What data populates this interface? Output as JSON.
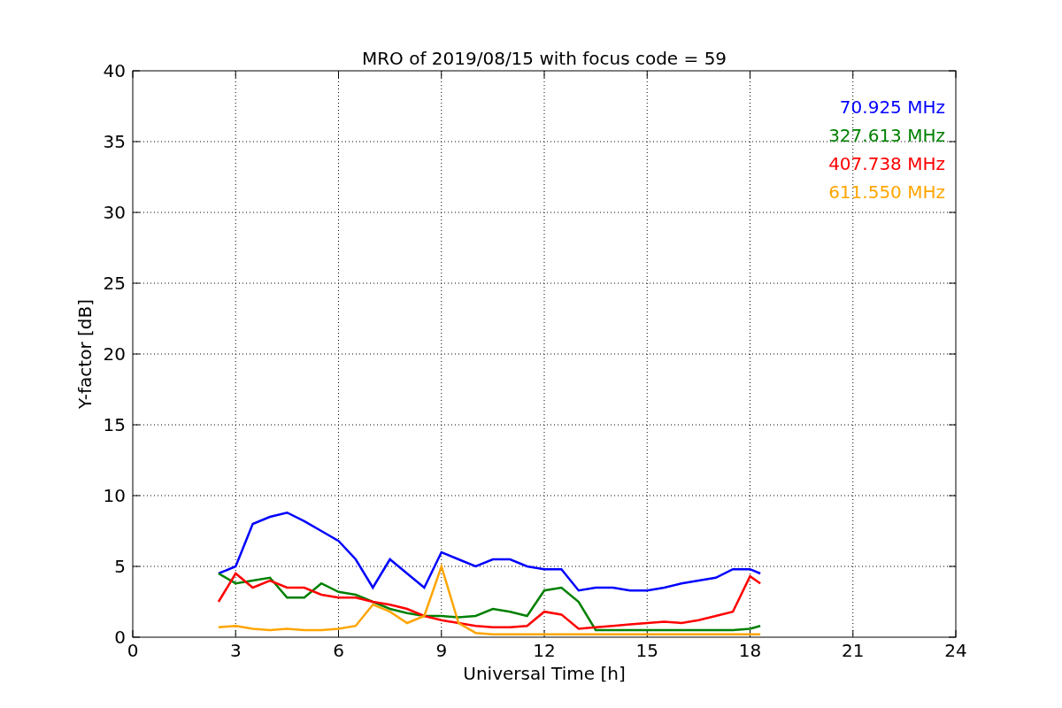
{
  "chart_data": {
    "type": "line",
    "title": "MRO of 2019/08/15 with focus code = 59",
    "xlabel": "Universal Time [h]",
    "ylabel": "Y-factor [dB]",
    "grid": true,
    "xlim": [
      0,
      24
    ],
    "ylim": [
      0,
      40
    ],
    "xticks": [
      0,
      3,
      6,
      9,
      12,
      15,
      18,
      21,
      24
    ],
    "yticks": [
      0,
      5,
      10,
      15,
      20,
      25,
      30,
      35,
      40
    ],
    "x": [
      2.5,
      3,
      3.5,
      4,
      4.5,
      5,
      5.5,
      6,
      6.5,
      7,
      7.5,
      8,
      8.5,
      9,
      9.5,
      10,
      10.5,
      11,
      11.5,
      12,
      12.5,
      13,
      13.5,
      14,
      14.5,
      15,
      15.5,
      16,
      16.5,
      17,
      17.5,
      18,
      18.3
    ],
    "series": [
      {
        "name": "70.925 MHz",
        "color": "#0000ff",
        "values": [
          4.5,
          5,
          8,
          8.5,
          8.8,
          8.2,
          7.5,
          6.8,
          5.5,
          3.5,
          5.5,
          4.5,
          3.5,
          6,
          5.5,
          5,
          5.5,
          5.5,
          5,
          4.8,
          4.8,
          3.3,
          3.5,
          3.5,
          3.3,
          3.3,
          3.5,
          3.8,
          4,
          4.2,
          4.8,
          4.8,
          4.5
        ]
      },
      {
        "name": "327.613 MHz",
        "color": "#008000",
        "values": [
          4.5,
          3.8,
          4,
          4.2,
          2.8,
          2.8,
          3.8,
          3.2,
          3,
          2.5,
          2,
          1.7,
          1.5,
          1.5,
          1.4,
          1.5,
          2,
          1.8,
          1.5,
          3.3,
          3.5,
          2.5,
          0.5,
          0.5,
          0.5,
          0.5,
          0.5,
          0.5,
          0.5,
          0.5,
          0.5,
          0.6,
          0.8
        ]
      },
      {
        "name": "407.738 MHz",
        "color": "#ff0000",
        "values": [
          2.5,
          4.5,
          3.5,
          4,
          3.5,
          3.5,
          3,
          2.8,
          2.8,
          2.5,
          2.3,
          2,
          1.5,
          1.2,
          1,
          0.8,
          0.7,
          0.7,
          0.8,
          1.8,
          1.6,
          0.6,
          0.7,
          0.8,
          0.9,
          1,
          1.1,
          1,
          1.2,
          1.5,
          1.8,
          4.3,
          3.8
        ]
      },
      {
        "name": "611.550 MHz",
        "color": "#ffa500",
        "values": [
          0.7,
          0.8,
          0.6,
          0.5,
          0.6,
          0.5,
          0.5,
          0.6,
          0.8,
          2.3,
          1.8,
          1,
          1.5,
          5,
          1,
          0.3,
          0.2,
          0.2,
          0.2,
          0.2,
          0.2,
          0.2,
          0.2,
          0.2,
          0.2,
          0.2,
          0.2,
          0.2,
          0.2,
          0.2,
          0.2,
          0.2,
          0.2
        ]
      }
    ]
  }
}
